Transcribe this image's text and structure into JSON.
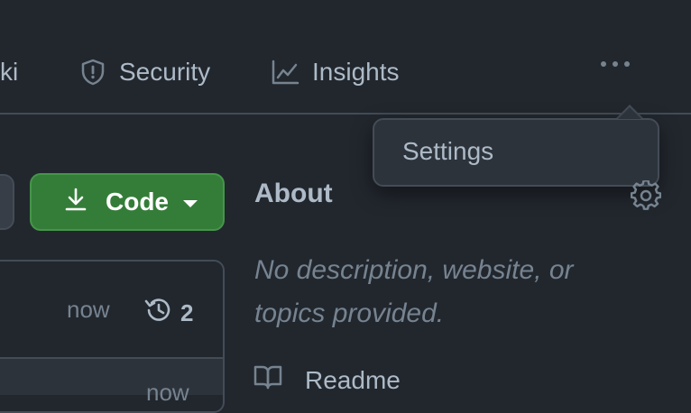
{
  "nav": {
    "partial_item": "ki",
    "security": "Security",
    "insights": "Insights",
    "more_icon": "kebab-horizontal-icon"
  },
  "dropdown": {
    "items": [
      "Settings"
    ]
  },
  "code_button": {
    "label": "Code",
    "icon": "download-icon"
  },
  "file_list": {
    "rows": [
      {
        "time": "now",
        "history_count": "2"
      },
      {
        "time": "now"
      }
    ]
  },
  "about": {
    "title": "About",
    "description_line1": "No description, website, or",
    "description_line2": "topics provided.",
    "readme": "Readme"
  },
  "colors": {
    "background": "#22272e",
    "border": "#444c56",
    "text": "#adbac7",
    "muted": "#768390",
    "code_button": "#347d39"
  }
}
